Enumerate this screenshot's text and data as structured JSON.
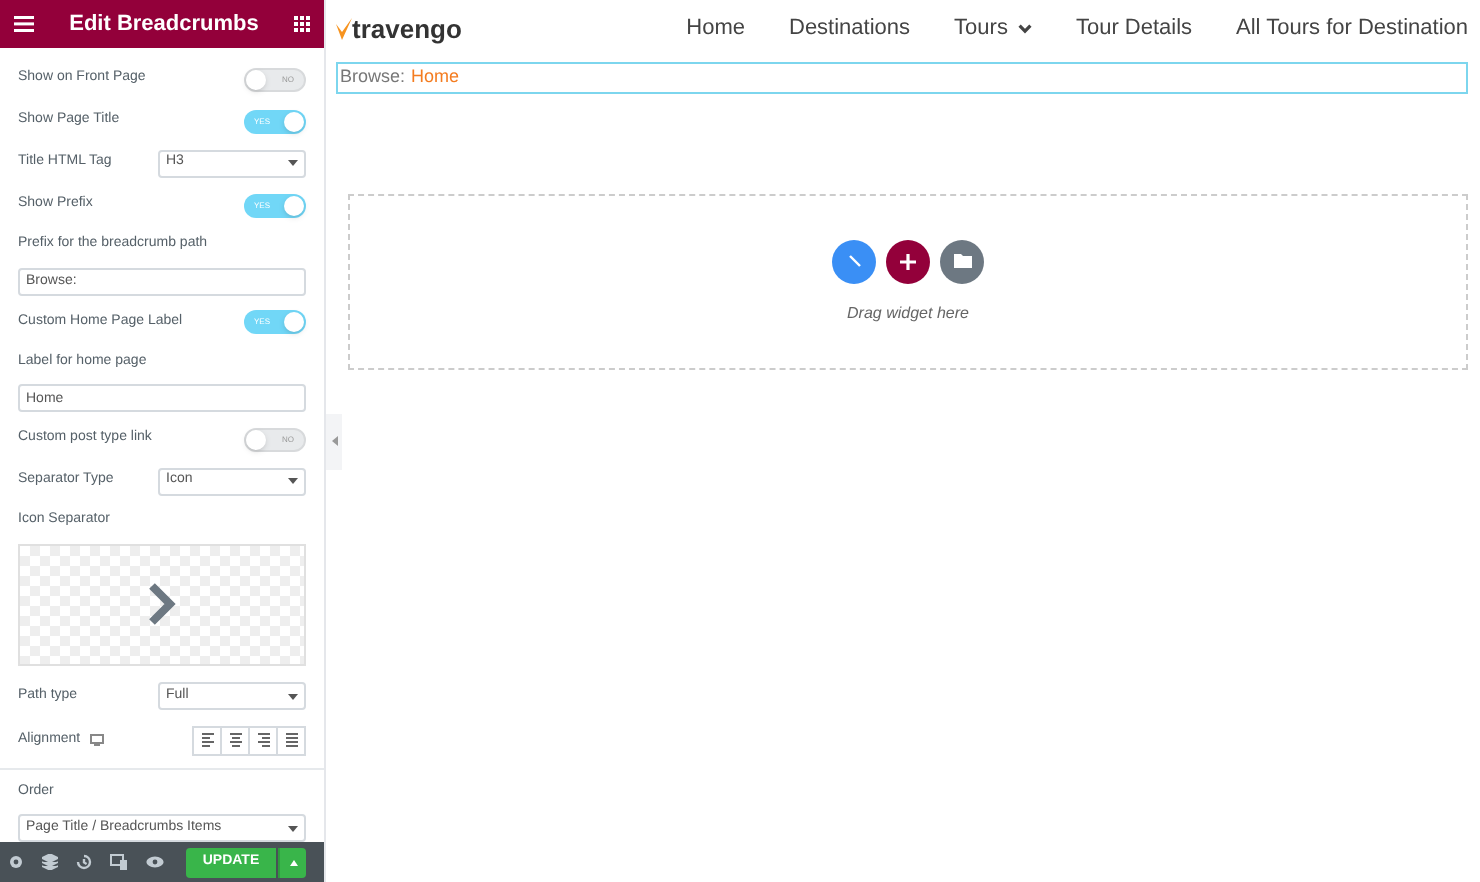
{
  "panel": {
    "title": "Edit Breadcrumbs",
    "controls": [
      {
        "kind": "switch",
        "label": "Show on Front Page",
        "on": false,
        "switch_text": "NO"
      },
      {
        "kind": "switch",
        "label": "Show Page Title",
        "on": true,
        "switch_text": "YES"
      },
      {
        "kind": "select",
        "label": "Title HTML Tag",
        "value": "H3"
      },
      {
        "kind": "switch",
        "label": "Show Prefix",
        "on": true,
        "switch_text": "YES"
      },
      {
        "kind": "input",
        "label": "Prefix for the breadcrumb path",
        "value": "Browse:"
      },
      {
        "kind": "switch",
        "label": "Custom Home Page Label",
        "on": true,
        "switch_text": "YES"
      },
      {
        "kind": "input",
        "label": "Label for home page",
        "value": "Home"
      },
      {
        "kind": "switch",
        "label": "Custom post type link",
        "on": false,
        "switch_text": "NO"
      },
      {
        "kind": "select",
        "label": "Separator Type",
        "value": "Icon"
      },
      {
        "kind": "icon_picker",
        "label": "Icon Separator"
      },
      {
        "kind": "select",
        "label": "Path type",
        "value": "Full"
      },
      {
        "kind": "alignment",
        "label": "Alignment"
      },
      {
        "kind": "divider"
      },
      {
        "kind": "wide_select",
        "label": "Order",
        "value": "Page Title / Breadcrumbs Items"
      }
    ],
    "footer": {
      "update_button": "UPDATE"
    }
  },
  "site": {
    "logo": "travengo",
    "nav": [
      {
        "label": "Home",
        "dropdown": false
      },
      {
        "label": "Destinations",
        "dropdown": false
      },
      {
        "label": "Tours",
        "dropdown": true
      },
      {
        "label": "Tour Details",
        "dropdown": false
      },
      {
        "label": "All Tours for Destination",
        "dropdown": false
      }
    ],
    "breadcrumb": {
      "prefix": "Browse:",
      "link": "Home"
    },
    "drop_zone": {
      "hint": "Drag widget here"
    }
  }
}
